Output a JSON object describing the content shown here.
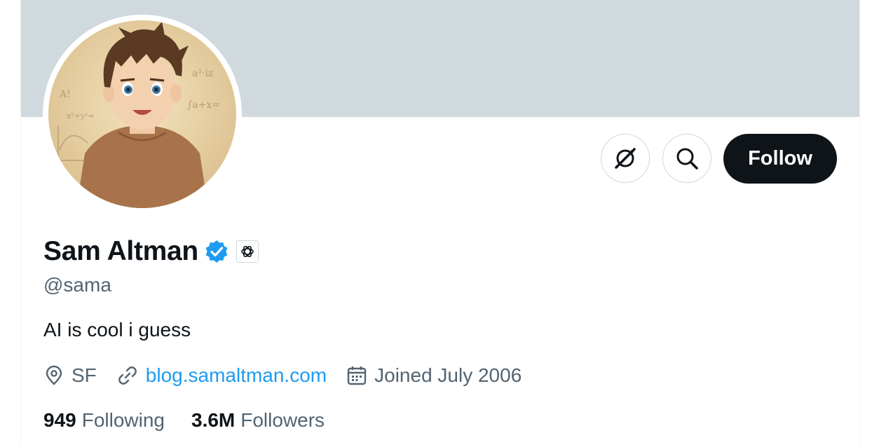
{
  "profile": {
    "name": "Sam Altman",
    "handle": "@sama",
    "bio": "AI is cool i guess",
    "location": "SF",
    "website": "blog.samaltman.com",
    "joined": "Joined July 2006",
    "following_count": "949",
    "following_label": "Following",
    "followers_count": "3.6M",
    "followers_label": "Followers"
  },
  "actions": {
    "follow_label": "Follow",
    "grok_icon": "grok-icon",
    "search_icon": "search-icon"
  },
  "badges": {
    "verified_icon": "verified-badge-icon",
    "affiliation_icon": "openai-logo-icon"
  },
  "avatar_doodles": {
    "text_1": "A!",
    "text_2": "a²·iz",
    "text_3": "∫a+x=",
    "text_4": "x²+y²="
  },
  "colors": {
    "banner": "#cfd9de",
    "follow_bg": "#0f1419",
    "link": "#1d9bf0",
    "verified": "#1d9bf0",
    "secondary_text": "#536471"
  }
}
